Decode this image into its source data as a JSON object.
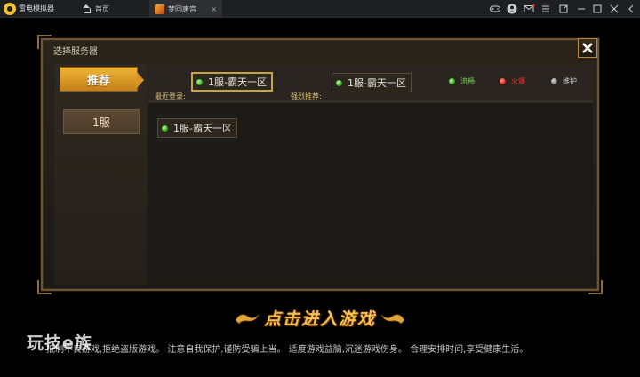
{
  "titlebar": {
    "app_name": "雷电模拟器",
    "tabs": [
      {
        "label": "首页"
      },
      {
        "label": "梦回唐宫",
        "close": "×"
      }
    ]
  },
  "dialog": {
    "title": "选择服务器",
    "left_tabs": {
      "recommended": "推荐",
      "server1": "1服"
    },
    "recent_label": "最近登录:",
    "strong_label": "强烈推荐:",
    "recent_server": "1服-霸天一区",
    "strong_server": "1服-霸天一区",
    "legend": {
      "smooth": "流畅",
      "hot": "火爆",
      "maintenance": "维护"
    },
    "server_list": [
      {
        "name": "1服-霸天一区",
        "status": "smooth"
      }
    ]
  },
  "enter_button": "点击进入游戏",
  "notice": "抵制不良游戏,拒绝盗版游戏。 注意自我保护,谨防受骗上当。 适度游戏益脑,沉迷游戏伤身。 合理安排时间,享受健康生活。",
  "watermark": "玩技e族",
  "colors": {
    "accent": "#f0b534",
    "smooth": "#4cc02a",
    "hot": "#e0241a",
    "maintenance": "#8a8a8a"
  }
}
